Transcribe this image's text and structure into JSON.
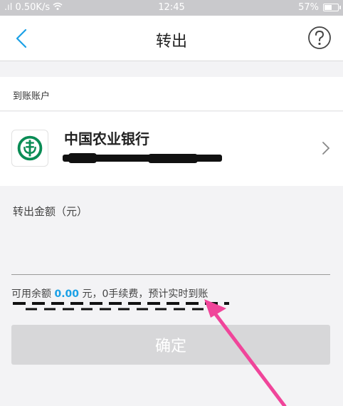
{
  "status_bar": {
    "signal": ".ıl 0.50K/s",
    "wifi_icon": "wifi-icon",
    "time": "12:45",
    "battery_text": "57%",
    "battery_level": 0.57
  },
  "nav": {
    "title": "转出",
    "back_icon": "chevron-left-icon",
    "help_icon": "question-circle-icon",
    "accent": "#1aa0e6"
  },
  "account_section": {
    "label": "到账账户",
    "bank_name": "中国农业银行",
    "bank_logo": "abc-bank-logo",
    "account_number_redacted": true,
    "chevron_icon": "chevron-right-icon",
    "logo_color": "#0a8c55"
  },
  "amount": {
    "label": "转出金额（元）",
    "value": "",
    "placeholder": ""
  },
  "balance_line": {
    "prefix": "可用余额 ",
    "value": "0.00",
    "suffix": " 元，0手续费，预计实时到账",
    "value_color": "#1aa0e6"
  },
  "confirm_button": {
    "label": "确定",
    "disabled": true
  },
  "annotation": {
    "arrow_color": "#f0459a",
    "dash_color": "#111111"
  }
}
